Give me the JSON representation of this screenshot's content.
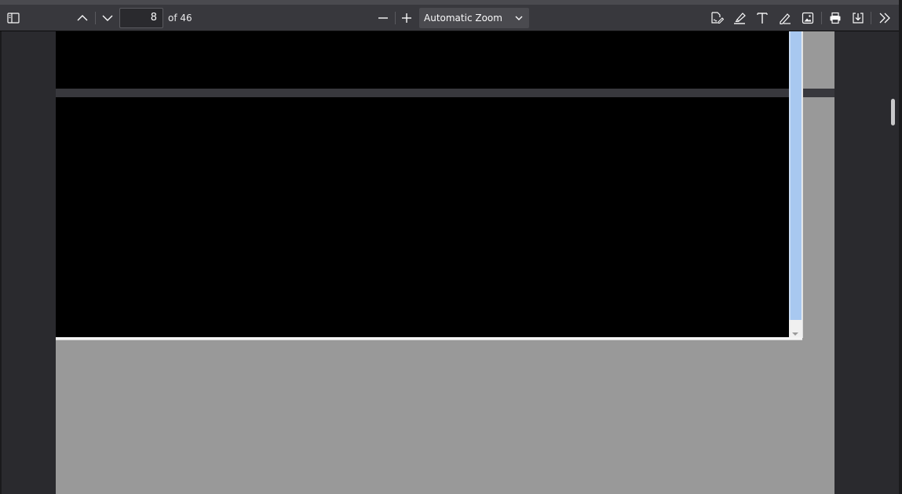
{
  "toolbar": {
    "page_number": "8",
    "page_count_label": "of 46",
    "zoom_value": "Automatic Zoom"
  },
  "icons": {
    "sidebar_toggle": "sidebar-toggle-icon",
    "previous_page": "chevron-up-icon",
    "next_page": "chevron-down-icon",
    "zoom_out": "minus-icon",
    "zoom_in": "plus-icon",
    "signature": "signature-icon",
    "highlight": "highlighter-icon",
    "text": "text-icon",
    "draw": "pen-icon",
    "image": "image-icon",
    "print": "printer-icon",
    "save": "download-icon",
    "tools": "double-chevron-right-icon"
  },
  "colors": {
    "toolbar_bg": "#38383d",
    "viewer_bg": "#2a2a2e",
    "page_bg": "#999999",
    "embed_scroll_accent": "#a8c8f0"
  }
}
